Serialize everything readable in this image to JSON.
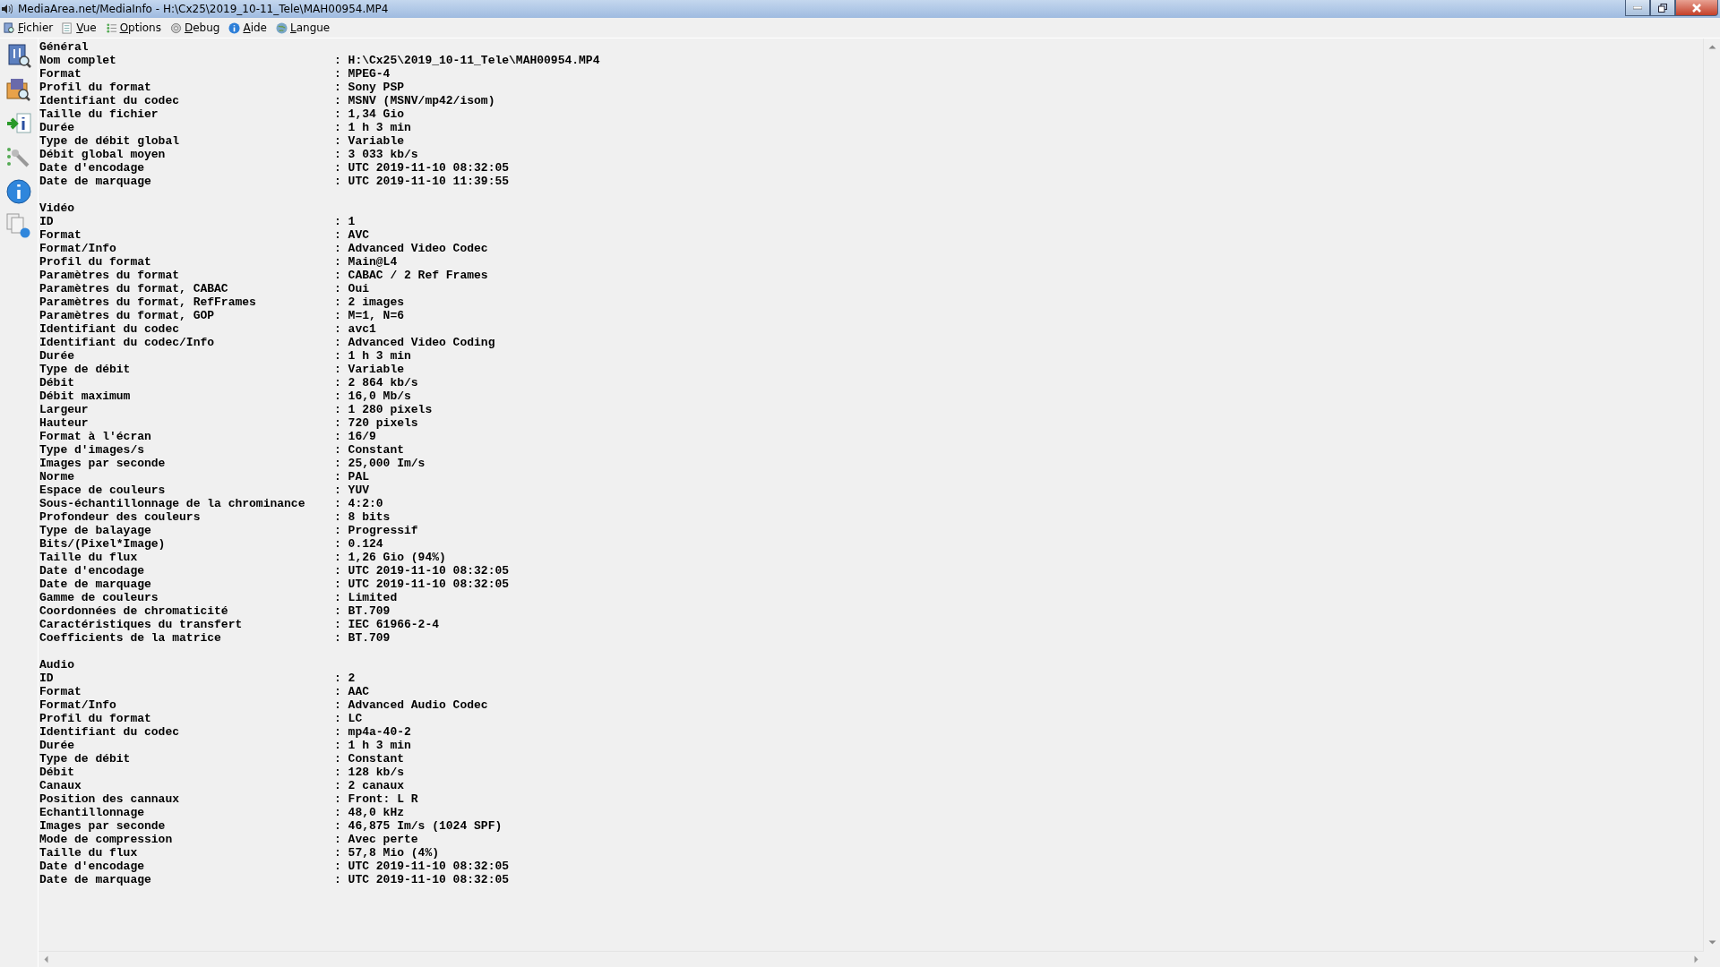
{
  "window": {
    "title": "MediaArea.net/MediaInfo - H:\\Cx25\\2019_10-11_Tele\\MAH00954.MP4"
  },
  "menu": [
    {
      "label": "Fichier"
    },
    {
      "label": "Vue"
    },
    {
      "label": "Options"
    },
    {
      "label": "Debug"
    },
    {
      "label": "Aide"
    },
    {
      "label": "Langue"
    }
  ],
  "sections": [
    {
      "heading": "Général",
      "rows": [
        {
          "label": "Nom complet",
          "value": ": H:\\Cx25\\2019_10-11_Tele\\MAH00954.MP4"
        },
        {
          "label": "Format",
          "value": ": MPEG-4"
        },
        {
          "label": "Profil du format",
          "value": ": Sony PSP"
        },
        {
          "label": "Identifiant du codec",
          "value": ": MSNV (MSNV/mp42/isom)"
        },
        {
          "label": "Taille du fichier",
          "value": ": 1,34 Gio"
        },
        {
          "label": "Durée",
          "value": ": 1 h 3 min"
        },
        {
          "label": "Type de débit global",
          "value": ": Variable"
        },
        {
          "label": "Débit global moyen",
          "value": ": 3 033 kb/s"
        },
        {
          "label": "Date d'encodage",
          "value": ": UTC 2019-11-10 08:32:05"
        },
        {
          "label": "Date de marquage",
          "value": ": UTC 2019-11-10 11:39:55"
        }
      ]
    },
    {
      "heading": "Vidéo",
      "rows": [
        {
          "label": "ID",
          "value": ": 1"
        },
        {
          "label": "Format",
          "value": ": AVC"
        },
        {
          "label": "Format/Info",
          "value": ": Advanced Video Codec"
        },
        {
          "label": "Profil du format",
          "value": ": Main@L4"
        },
        {
          "label": "Paramètres du format",
          "value": ": CABAC / 2 Ref Frames"
        },
        {
          "label": "Paramètres du format, CABAC",
          "value": ": Oui"
        },
        {
          "label": "Paramètres du format, RefFrames",
          "value": ": 2 images"
        },
        {
          "label": "Paramètres du format, GOP",
          "value": ": M=1, N=6"
        },
        {
          "label": "Identifiant du codec",
          "value": ": avc1"
        },
        {
          "label": "Identifiant du codec/Info",
          "value": ": Advanced Video Coding"
        },
        {
          "label": "Durée",
          "value": ": 1 h 3 min"
        },
        {
          "label": "Type de débit",
          "value": ": Variable"
        },
        {
          "label": "Débit",
          "value": ": 2 864 kb/s"
        },
        {
          "label": "Débit maximum",
          "value": ": 16,0 Mb/s"
        },
        {
          "label": "Largeur",
          "value": ": 1 280 pixels"
        },
        {
          "label": "Hauteur",
          "value": ": 720 pixels"
        },
        {
          "label": "Format à l'écran",
          "value": ": 16/9"
        },
        {
          "label": "Type d'images/s",
          "value": ": Constant"
        },
        {
          "label": "Images par seconde",
          "value": ": 25,000 Im/s"
        },
        {
          "label": "Norme",
          "value": ": PAL"
        },
        {
          "label": "Espace de couleurs",
          "value": ": YUV"
        },
        {
          "label": "Sous-échantillonnage de la chrominance",
          "value": ": 4:2:0"
        },
        {
          "label": "Profondeur des couleurs",
          "value": ": 8 bits"
        },
        {
          "label": "Type de balayage",
          "value": ": Progressif"
        },
        {
          "label": "Bits/(Pixel*Image)",
          "value": ": 0.124"
        },
        {
          "label": "Taille du flux",
          "value": ": 1,26 Gio (94%)"
        },
        {
          "label": "Date d'encodage",
          "value": ": UTC 2019-11-10 08:32:05"
        },
        {
          "label": "Date de marquage",
          "value": ": UTC 2019-11-10 08:32:05"
        },
        {
          "label": "Gamme de couleurs",
          "value": ": Limited"
        },
        {
          "label": "Coordonnées de chromaticité",
          "value": ": BT.709"
        },
        {
          "label": "Caractéristiques du transfert",
          "value": ": IEC 61966-2-4"
        },
        {
          "label": "Coefficients de la matrice",
          "value": ": BT.709"
        }
      ]
    },
    {
      "heading": "Audio",
      "rows": [
        {
          "label": "ID",
          "value": ": 2"
        },
        {
          "label": "Format",
          "value": ": AAC"
        },
        {
          "label": "Format/Info",
          "value": ": Advanced Audio Codec"
        },
        {
          "label": "Profil du format",
          "value": ": LC"
        },
        {
          "label": "Identifiant du codec",
          "value": ": mp4a-40-2"
        },
        {
          "label": "Durée",
          "value": ": 1 h 3 min"
        },
        {
          "label": "Type de débit",
          "value": ": Constant"
        },
        {
          "label": "Débit",
          "value": ": 128 kb/s"
        },
        {
          "label": "Canaux",
          "value": ": 2 canaux"
        },
        {
          "label": "Position des cannaux",
          "value": ": Front: L R"
        },
        {
          "label": "Echantillonnage",
          "value": ": 48,0 kHz"
        },
        {
          "label": "Images par seconde",
          "value": ": 46,875 Im/s (1024 SPF)"
        },
        {
          "label": "Mode de compression",
          "value": ": Avec perte"
        },
        {
          "label": "Taille du flux",
          "value": ": 57,8 Mio (4%)"
        },
        {
          "label": "Date d'encodage",
          "value": ": UTC 2019-11-10 08:32:05"
        },
        {
          "label": "Date de marquage",
          "value": ": UTC 2019-11-10 08:32:05"
        }
      ]
    }
  ]
}
